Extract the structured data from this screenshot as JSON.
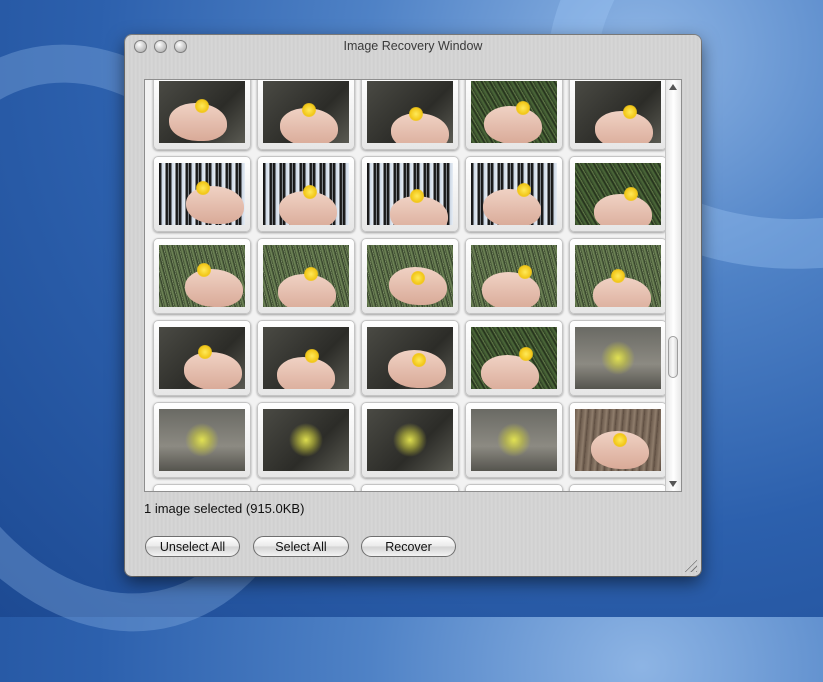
{
  "window": {
    "title": "Image Recovery Window"
  },
  "status": {
    "text": "1 image selected (915.0KB)"
  },
  "buttons": {
    "unselect_all": "Unselect All",
    "select_all": "Select All",
    "recover": "Recover"
  },
  "thumbnails": [
    {
      "scene": "hand-flower",
      "bg": "ground"
    },
    {
      "scene": "hand-flower",
      "bg": "ground"
    },
    {
      "scene": "hand-flower",
      "bg": "ground"
    },
    {
      "scene": "hand-flower",
      "bg": "leafy"
    },
    {
      "scene": "hand-flower",
      "bg": "ground"
    },
    {
      "scene": "hand-flower",
      "bg": "trees"
    },
    {
      "scene": "hand-flower",
      "bg": "trees"
    },
    {
      "scene": "hand-flower",
      "bg": "trees"
    },
    {
      "scene": "hand-flower",
      "bg": "trees"
    },
    {
      "scene": "hand-flower",
      "bg": "leafy"
    },
    {
      "scene": "hand-flower",
      "bg": "grass"
    },
    {
      "scene": "hand-flower",
      "bg": "grass"
    },
    {
      "scene": "hand-flower",
      "bg": "grass"
    },
    {
      "scene": "hand-flower",
      "bg": "grass"
    },
    {
      "scene": "hand-flower",
      "bg": "grass"
    },
    {
      "scene": "hand-flower",
      "bg": "ground"
    },
    {
      "scene": "hand-flower",
      "bg": "ground"
    },
    {
      "scene": "hand-flower",
      "bg": "ground"
    },
    {
      "scene": "hand-flower",
      "bg": "leafy"
    },
    {
      "scene": "plant",
      "bg": "sand"
    },
    {
      "scene": "plant",
      "bg": "sand"
    },
    {
      "scene": "plant",
      "bg": "ground"
    },
    {
      "scene": "plant",
      "bg": "ground"
    },
    {
      "scene": "plant",
      "bg": "sand"
    },
    {
      "scene": "hand-flower",
      "bg": "bark"
    },
    {
      "scene": "partial",
      "bg": "sand"
    },
    {
      "scene": "partial",
      "bg": "sand"
    },
    {
      "scene": "partial",
      "bg": "sand"
    },
    {
      "scene": "partial",
      "bg": "sand"
    },
    {
      "scene": "partial",
      "bg": "sand"
    }
  ]
}
